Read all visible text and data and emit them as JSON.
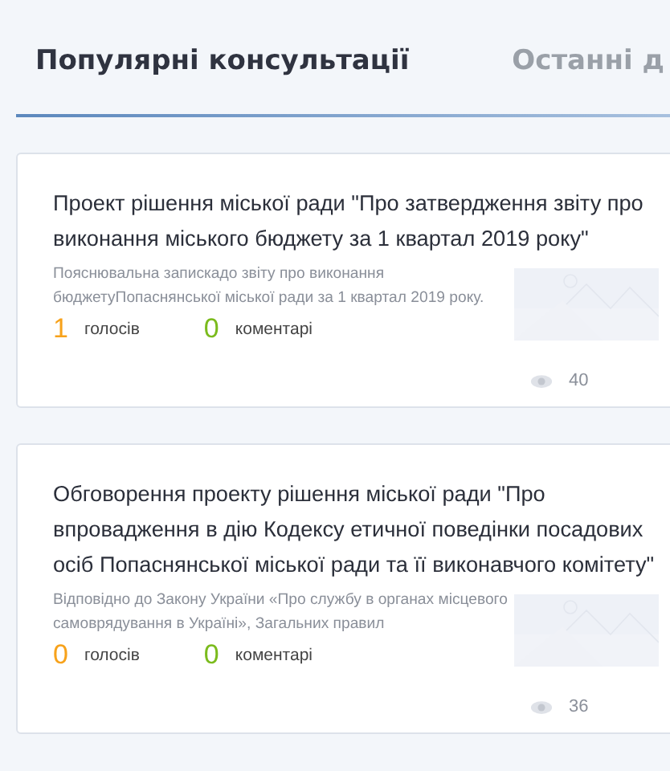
{
  "tabs": [
    {
      "label": "Популярні консультації",
      "selected": true
    },
    {
      "label": "Останні д",
      "selected": false
    }
  ],
  "cards": [
    {
      "title": "Проект рішення міської ради \"Про затвердження звіту про виконання міського бюджету за 1 квартал 2019 року\"",
      "description": "Пояснювальна запискадо звіту про виконання бюджетуПопаснянської міської ради за 1 квартал 2019 року.",
      "votes": "1",
      "votes_label": "голосів",
      "comments": "0",
      "comments_label": "коментарі",
      "views": "40"
    },
    {
      "title": "Обговорення проекту рішення міської ради \"Про впровадження в дію Кодексу етичної поведінки посадових осіб Попаснянської міської ради та її виконавчого комітету\"",
      "description": "Відповідно до Закону України «Про службу в органах місцевого самоврядування в Україні», Загальних правил",
      "votes": "0",
      "votes_label": "голосів",
      "comments": "0",
      "comments_label": "коментарі",
      "views": "36"
    }
  ]
}
